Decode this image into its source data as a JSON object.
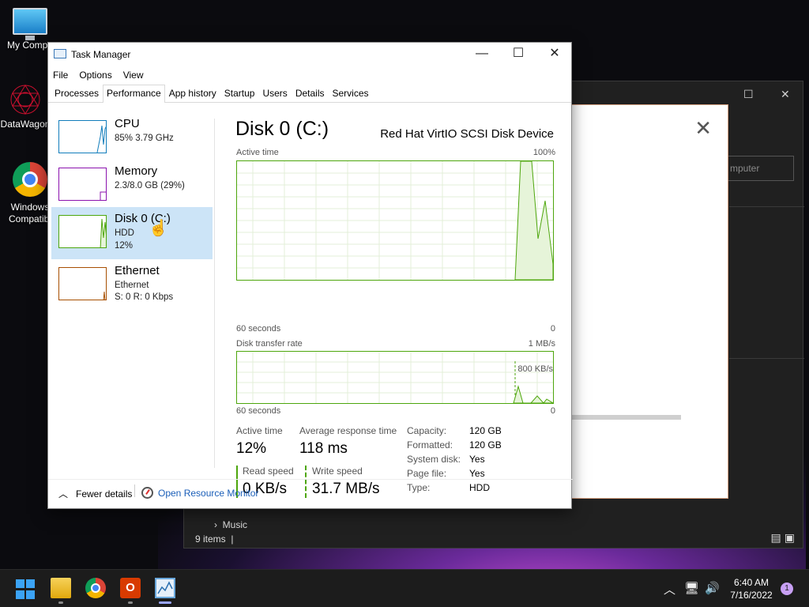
{
  "desktop": {
    "icons": [
      {
        "label": "My Compu",
        "icon": "computer-icon"
      },
      {
        "label": "DataWagon",
        "icon": "datawagon-icon"
      },
      {
        "label": "Windows Compatibi",
        "icon": "chrome-icon"
      }
    ]
  },
  "background_window": {
    "search_placeholder": "mputer",
    "status": "9 items",
    "tree_item": "Music"
  },
  "task_manager": {
    "title": "Task Manager",
    "menu": [
      "File",
      "Options",
      "View"
    ],
    "tabs": [
      "Processes",
      "Performance",
      "App history",
      "Startup",
      "Users",
      "Details",
      "Services"
    ],
    "active_tab": "Performance",
    "sidebar": [
      {
        "name": "CPU",
        "sub1": "85%  3.79 GHz",
        "sub2": "",
        "color": "#117dbb"
      },
      {
        "name": "Memory",
        "sub1": "2.3/8.0 GB (29%)",
        "sub2": "",
        "color": "#8b12ae"
      },
      {
        "name": "Disk 0 (C:)",
        "sub1": "HDD",
        "sub2": "12%",
        "color": "#4da60c"
      },
      {
        "name": "Ethernet",
        "sub1": "Ethernet",
        "sub2": "S: 0  R: 0 Kbps",
        "color": "#a74f01"
      }
    ],
    "detail": {
      "title": "Disk 0 (C:)",
      "model": "Red Hat VirtIO SCSI Disk Device",
      "chart1": {
        "label": "Active time",
        "max": "100%",
        "time": "60 seconds",
        "min": "0"
      },
      "chart2": {
        "label": "Disk transfer rate",
        "max": "1 MB/s",
        "marker": "800 KB/s",
        "time": "60 seconds",
        "min": "0"
      },
      "active_time_label": "Active time",
      "active_time_value": "12%",
      "avg_response_label": "Average response time",
      "avg_response_value": "118 ms",
      "read_speed_label": "Read speed",
      "read_speed_value": "0 KB/s",
      "write_speed_label": "Write speed",
      "write_speed_value": "31.7 MB/s",
      "props": [
        {
          "k": "Capacity:",
          "v": "120 GB"
        },
        {
          "k": "Formatted:",
          "v": "120 GB"
        },
        {
          "k": "System disk:",
          "v": "Yes"
        },
        {
          "k": "Page file:",
          "v": "Yes"
        },
        {
          "k": "Type:",
          "v": "HDD"
        }
      ]
    },
    "footer": {
      "fewer_details": "Fewer details",
      "open_resource_monitor": "Open Resource Monitor"
    }
  },
  "taskbar": {
    "clock_time": "6:40 AM",
    "clock_date": "7/16/2022",
    "notification_count": "1"
  }
}
